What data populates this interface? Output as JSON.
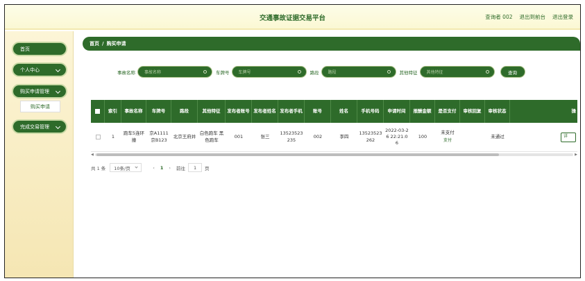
{
  "header": {
    "title": "交通事故证据交易平台",
    "user": "查询者 002",
    "back_label": "退出到前台",
    "logout_label": "退出登录"
  },
  "sidebar": {
    "items": [
      {
        "label": "首页"
      },
      {
        "label": "个人中心"
      },
      {
        "label": "购买申请管理"
      },
      {
        "label": "完成交易管理"
      }
    ],
    "sub_item": "购买申请"
  },
  "breadcrumb": {
    "home": "首页",
    "sep": "/",
    "current": "购买申请"
  },
  "search": {
    "fields": [
      {
        "label": "事故名称",
        "placeholder": "事故名称"
      },
      {
        "label": "车牌号",
        "placeholder": "车牌号"
      },
      {
        "label": "路段",
        "placeholder": "路段"
      },
      {
        "label": "其他特征",
        "placeholder": "其他特征"
      }
    ],
    "button": "查询"
  },
  "table": {
    "headers": [
      "索引",
      "事故名称",
      "车牌号",
      "路段",
      "其他特征",
      "发布者账号",
      "发布者姓名",
      "发布者手机",
      "账号",
      "姓名",
      "手机号码",
      "申请时间",
      "报酬金额",
      "是否支付",
      "审核回复",
      "审核状态",
      "操"
    ],
    "row": {
      "index": "1",
      "accident": "跑车5连环撞",
      "plate": "京A1111 京B123",
      "road": "北京王府井",
      "features": "白色跑车 黑色跑车",
      "pub_account": "001",
      "pub_name": "张三",
      "pub_phone": "13523523235",
      "account": "002",
      "name": "李四",
      "phone": "13523523262",
      "apply_time": "2022-03-26 22:21:06",
      "amount": "100",
      "paid": "未支付",
      "pay_link": "支付",
      "reply": "",
      "status": "未通过",
      "action": "详"
    }
  },
  "pagination": {
    "total": "共 1 条",
    "page_size": "10条/页",
    "prev": "‹",
    "current": "1",
    "next": "›",
    "goto_label": "前往",
    "goto_value": "1",
    "page_unit": "页"
  }
}
